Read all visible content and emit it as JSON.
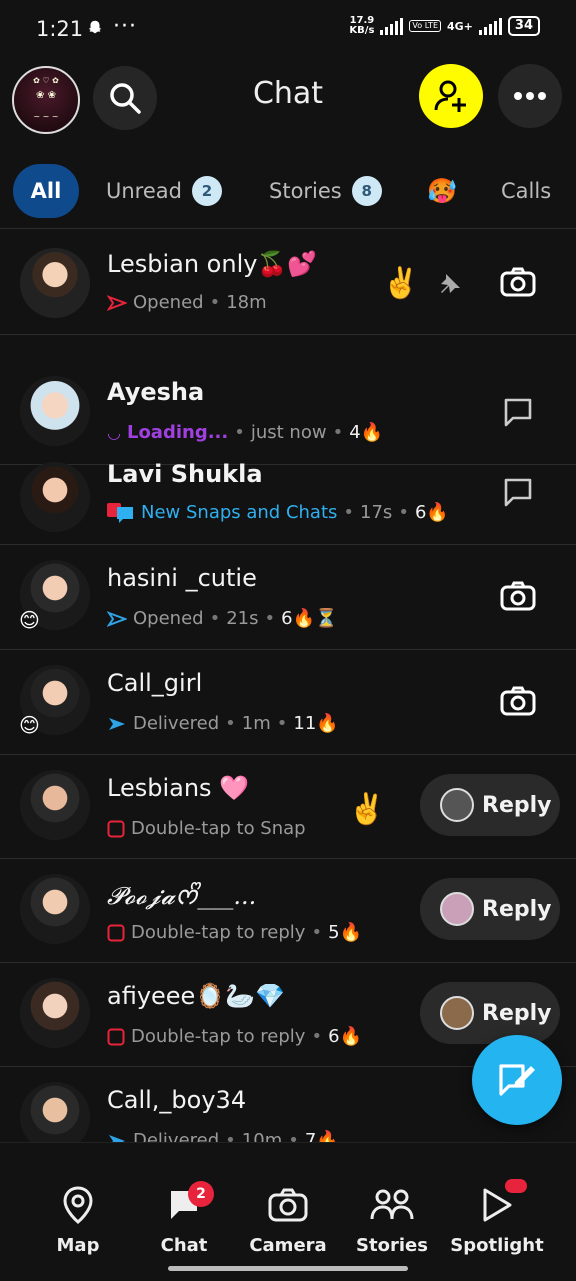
{
  "status_bar": {
    "time": "1:21",
    "dots": "···",
    "net_speed_top": "17.9",
    "net_speed_bottom": "KB/s",
    "volte": "Vo LTE",
    "network": "4G+",
    "battery": "34"
  },
  "header": {
    "title": "Chat"
  },
  "tabs": [
    {
      "label": "All"
    },
    {
      "label": "Unread",
      "badge": "2"
    },
    {
      "label": "Stories",
      "badge": "8"
    },
    {
      "label": "🥵"
    },
    {
      "label": "Calls"
    }
  ],
  "chats": [
    {
      "name": "Lesbian only🍒💕",
      "status": "Opened",
      "time": "18m",
      "side_emoji": "✌️",
      "pinned": true,
      "action": "camera"
    },
    {
      "name": "Ayesha",
      "status": "Loading...",
      "time": "just now",
      "streak": "4🔥",
      "action": "chat"
    },
    {
      "name": "Lavi Shukla",
      "status": "New Snaps and Chats",
      "time": "17s",
      "streak": "6🔥",
      "action": "chat"
    },
    {
      "name": "hasini _cutie",
      "status": "Opened",
      "time": "21s",
      "streak": "6🔥⏳",
      "action": "camera"
    },
    {
      "name": "Call_girl",
      "status": "Delivered",
      "time": "1m",
      "streak": "11🔥",
      "action": "camera"
    },
    {
      "name": "Lesbians 🩷",
      "status": "Double-tap to Snap",
      "side_emoji": "✌️",
      "action": "Reply"
    },
    {
      "name": "𝓟𝓸𝓸𝓳𝓪ᰔᩚ___...",
      "status": "Double-tap to reply",
      "streak": "5🔥",
      "action": "Reply"
    },
    {
      "name": "afiyeee🪞🦢💎",
      "status": "Double-tap to reply",
      "streak": "6🔥",
      "action": "Reply"
    },
    {
      "name": "Call,_boy34",
      "status": "Delivered",
      "time": "10m",
      "streak": "7🔥",
      "action": "chat"
    }
  ],
  "bottom_nav": [
    {
      "label": "Map"
    },
    {
      "label": "Chat",
      "badge": "2"
    },
    {
      "label": "Camera"
    },
    {
      "label": "Stories"
    },
    {
      "label": "Spotlight"
    }
  ],
  "colors": {
    "accent_yellow": "#FFFC00",
    "all_tab": "#0E4A8C",
    "fab": "#24B4F0",
    "opened_red": "#E8243C",
    "opened_blue": "#2FA3E8",
    "loading_purple": "#A040E0",
    "new_snaps_blue": "#2FB0F0"
  }
}
